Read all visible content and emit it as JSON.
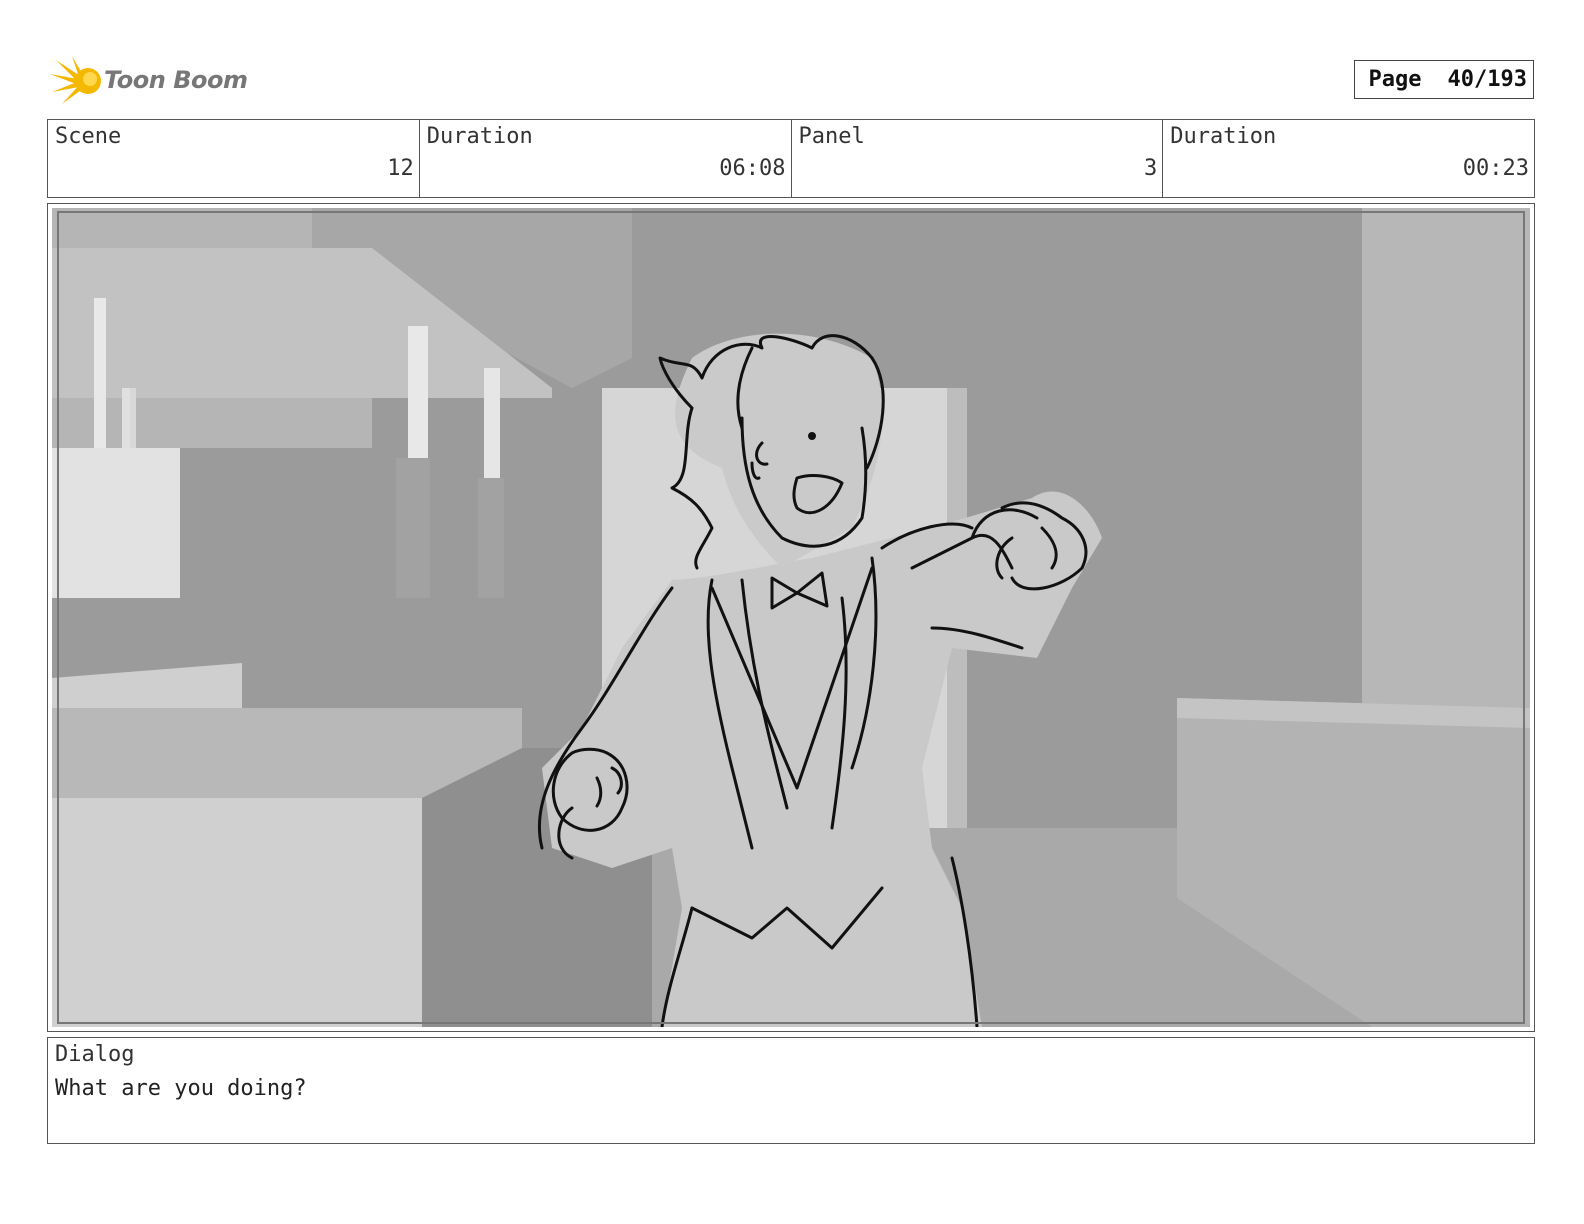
{
  "header": {
    "logo_text": "Toon Boom",
    "page_label": "Page",
    "page_value": "40/193"
  },
  "info": {
    "scene_label": "Scene",
    "scene_value": "12",
    "scene_duration_label": "Duration",
    "scene_duration_value": "06:08",
    "panel_label": "Panel",
    "panel_value": "3",
    "panel_duration_label": "Duration",
    "panel_duration_value": "00:23"
  },
  "dialog": {
    "label": "Dialog",
    "text": "What are you doing?"
  },
  "colors": {
    "logo_yellow": "#f5b800",
    "frame_border": "#555555"
  }
}
